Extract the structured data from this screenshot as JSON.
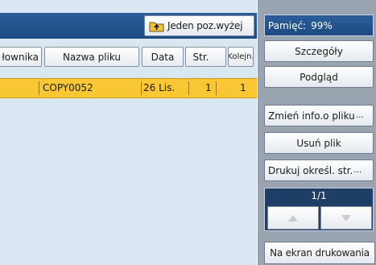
{
  "toolbar": {
    "up_label": "Jeden poz.wyżej"
  },
  "columns": {
    "owner": "łownika",
    "name": "Nazwa pliku",
    "date": "Data",
    "pages": "Str.",
    "order": "Kolejn."
  },
  "rows": [
    {
      "name": "COPY0052",
      "date": "26 Lis.",
      "pages": "1",
      "order": "1"
    }
  ],
  "side": {
    "memory_label": "Pamięć:",
    "memory_value": "99%",
    "details": "Szczegóły",
    "preview": "Podgląd",
    "change_info": "Zmień info.o pliku",
    "delete": "Usuń plik",
    "print_pages": "Drukuj określ. str.",
    "page_indicator": "1/1",
    "print_screen": "Na ekran drukowania"
  },
  "colors": {
    "selected_row": "#f8c733",
    "header_bar": "#2b5e9a",
    "panel_bg": "#9aa4b1",
    "list_bg": "#dbe6f3"
  },
  "icons": {
    "up": "folder-up-icon",
    "page_up": "triangle-up-icon",
    "page_down": "triangle-down-icon"
  }
}
